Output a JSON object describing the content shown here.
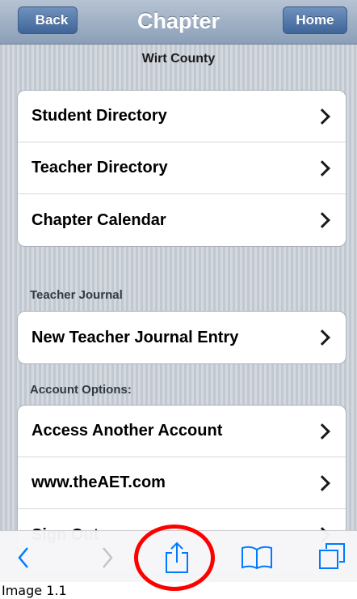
{
  "navbar": {
    "back_label": "Back",
    "title": "Chapter",
    "home_label": "Home"
  },
  "subtitle": "Wirt County",
  "directory_group": [
    {
      "label": "Student Directory"
    },
    {
      "label": "Teacher Directory"
    },
    {
      "label": "Chapter Calendar"
    }
  ],
  "journal_section": {
    "header": "Teacher Journal",
    "items": [
      {
        "label": "New Teacher Journal Entry"
      }
    ]
  },
  "account_section": {
    "header": "Account Options:",
    "items": [
      {
        "label": "Access Another Account"
      },
      {
        "label": "www.theAET.com"
      },
      {
        "label": "Sign Out"
      }
    ]
  },
  "toolbar": {
    "icons": [
      "back-arrow-icon",
      "forward-arrow-icon",
      "share-icon",
      "bookmarks-icon",
      "tabs-icon"
    ]
  },
  "colors": {
    "accent": "#007aff",
    "nav_button": "#4a6fa5",
    "highlight": "#ff0000"
  },
  "caption": "Image 1.1"
}
